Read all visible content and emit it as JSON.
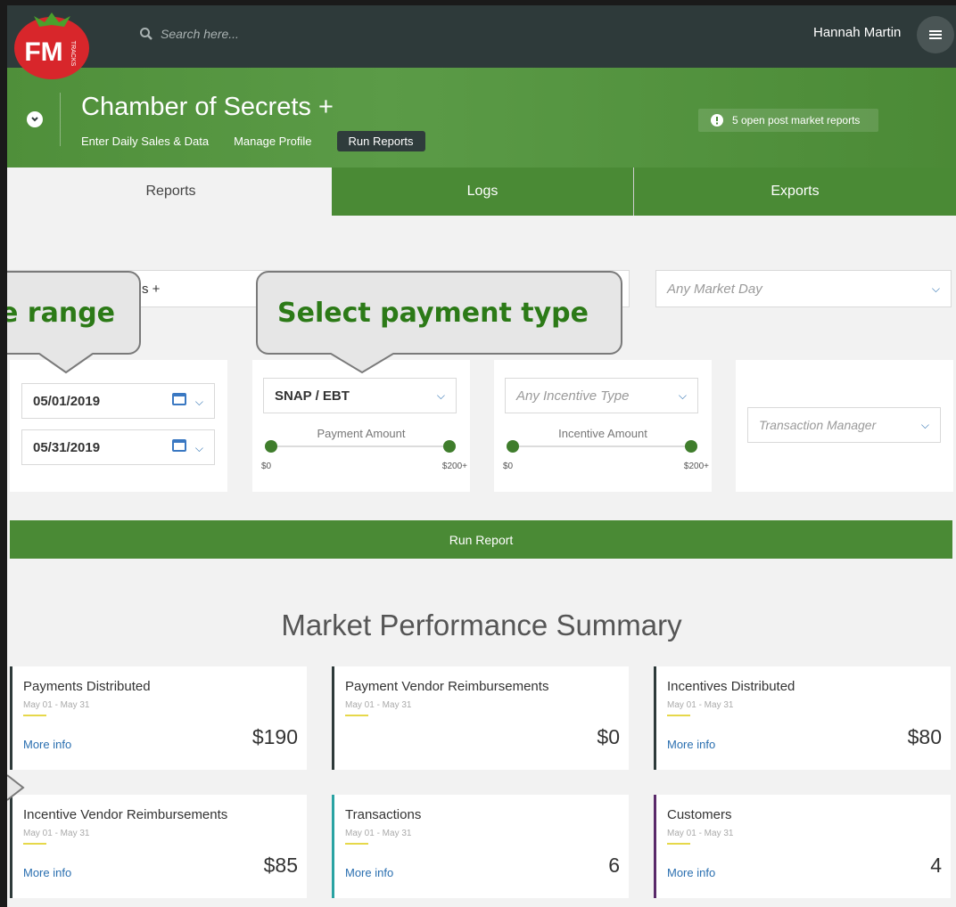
{
  "topbar": {
    "logo_text": "FM",
    "logo_subtext": "TRACKS",
    "search_placeholder": "Search here...",
    "username": "Hannah Martin"
  },
  "header": {
    "market_title": "Chamber of Secrets +",
    "subnav": [
      "Enter Daily Sales & Data",
      "Manage Profile",
      "Run Reports"
    ],
    "open_reports": "5 open post market reports"
  },
  "tabs": [
    {
      "label": "Reports",
      "active": true
    },
    {
      "label": "Logs",
      "active": false
    },
    {
      "label": "Exports",
      "active": false
    }
  ],
  "filters": {
    "market_select_partial": "s +",
    "market_day_placeholder": "Any Market Day",
    "start_date": "05/01/2019",
    "end_date": "05/31/2019",
    "payment_type": "SNAP / EBT",
    "payment_amount_label": "Payment Amount",
    "payment_min": "$0",
    "payment_max": "$200+",
    "incentive_type_placeholder": "Any Incentive Type",
    "incentive_amount_label": "Incentive Amount",
    "incentive_min": "$0",
    "incentive_max": "$200+",
    "transaction_manager_placeholder": "Transaction Manager"
  },
  "run_report_label": "Run Report",
  "summary": {
    "title": "Market Performance Summary",
    "cards": [
      {
        "label": "Payments Distributed",
        "date": "May 01 - May 31",
        "more": "More info",
        "value": "$190",
        "accent": "#2e3a3a"
      },
      {
        "label": "Payment Vendor Reimbursements",
        "date": "May 01 - May 31",
        "more": "",
        "value": "$0",
        "accent": "#2e3a3a"
      },
      {
        "label": "Incentives Distributed",
        "date": "May 01 - May 31",
        "more": "More info",
        "value": "$80",
        "accent": "#2e3a3a"
      },
      {
        "label": "Incentive Vendor Reimbursements",
        "date": "May 01 - May 31",
        "more": "More info",
        "value": "$85",
        "accent": "#2e3a3a"
      },
      {
        "label": "Transactions",
        "date": "May 01 - May 31",
        "more": "More info",
        "value": "6",
        "accent": "#2aa3a3"
      },
      {
        "label": "Customers",
        "date": "May 01 - May 31",
        "more": "More info",
        "value": "4",
        "accent": "#5a2a6a"
      }
    ]
  },
  "callouts": {
    "date_range": "e range",
    "payment_type": "Select payment type"
  },
  "colors": {
    "green": "#4a8a35",
    "dark": "#2e3a3a",
    "callout_text": "#2c7a17",
    "link": "#2a6fb0"
  }
}
